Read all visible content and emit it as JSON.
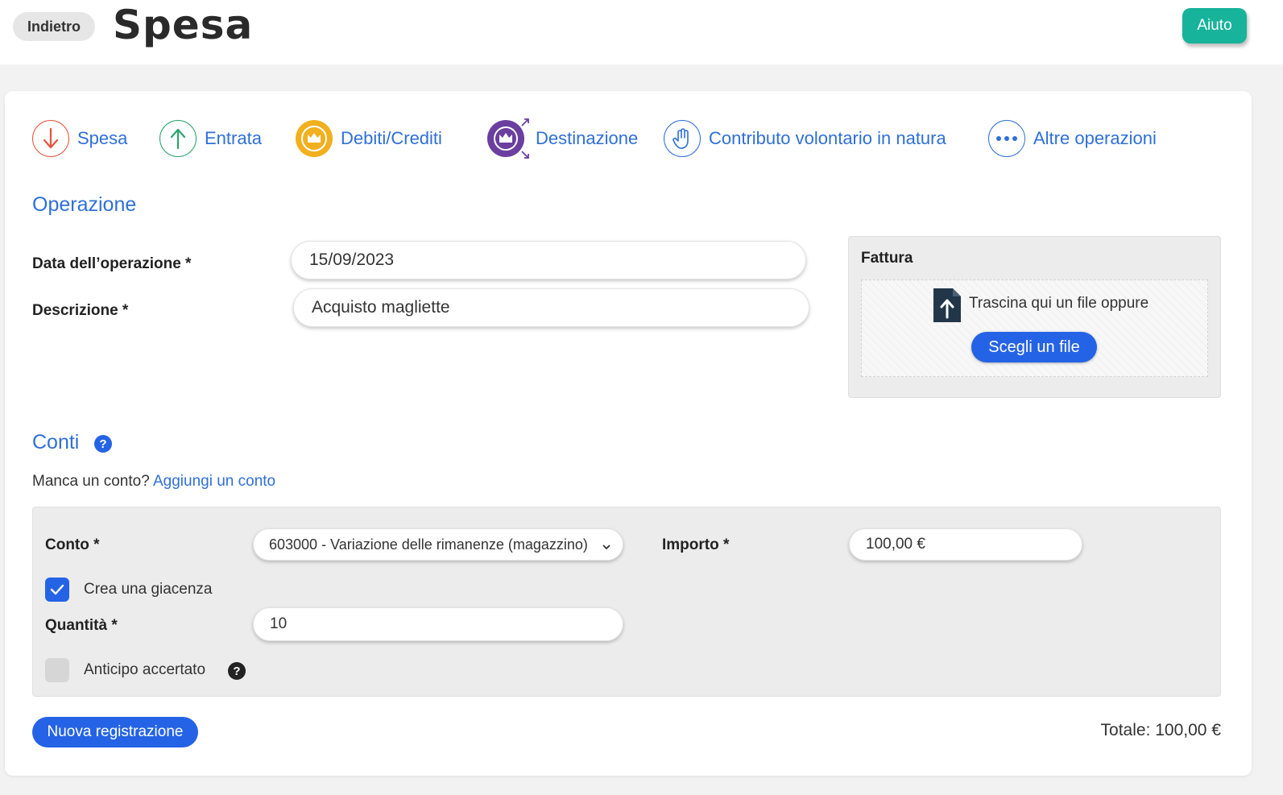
{
  "header": {
    "back_label": "Indietro",
    "title": "Spesa",
    "help_label": "Aiuto"
  },
  "operation_types": [
    {
      "label": "Spesa",
      "icon": "arrow-down-icon",
      "color": "#e5533d"
    },
    {
      "label": "Entrata",
      "icon": "arrow-up-icon",
      "color": "#2aa36b"
    },
    {
      "label": "Debiti/Crediti",
      "icon": "crown-icon",
      "color": "#f2b01e"
    },
    {
      "label": "Destinazione",
      "icon": "crown-arrows-icon",
      "color": "#6b3fa0"
    },
    {
      "label": "Contributo volontario in natura",
      "icon": "hand-icon",
      "color": "#2f6fd8"
    },
    {
      "label": "Altre operazioni",
      "icon": "more-icon",
      "color": "#2f6fd8"
    }
  ],
  "operation": {
    "section_title": "Operazione",
    "date_label": "Data dell’operazione *",
    "date_value": "15/09/2023",
    "description_label": "Descrizione *",
    "description_value": "Acquisto magliette"
  },
  "invoice": {
    "title": "Fattura",
    "drop_text": "Trascina qui un file oppure",
    "choose_label": "Scegli un file"
  },
  "accounts": {
    "section_title": "Conti",
    "missing_text": "Manca un conto?",
    "add_link": "Aggiungi un conto",
    "account_label": "Conto *",
    "account_value": "603000 - Variazione delle rimanenze (magazzino)",
    "amount_label": "Importo *",
    "amount_value": "100,00 €",
    "create_stock_label": "Crea una giacenza",
    "create_stock_checked": true,
    "quantity_label": "Quantità *",
    "quantity_value": "10",
    "advance_label": "Anticipo accertato",
    "advance_checked": false
  },
  "footer": {
    "new_label": "Nuova registrazione",
    "total_text": "Totale: 100,00 €"
  },
  "colors": {
    "primary": "#2563e6",
    "link": "#2f6fd8",
    "help": "#17b39a"
  }
}
